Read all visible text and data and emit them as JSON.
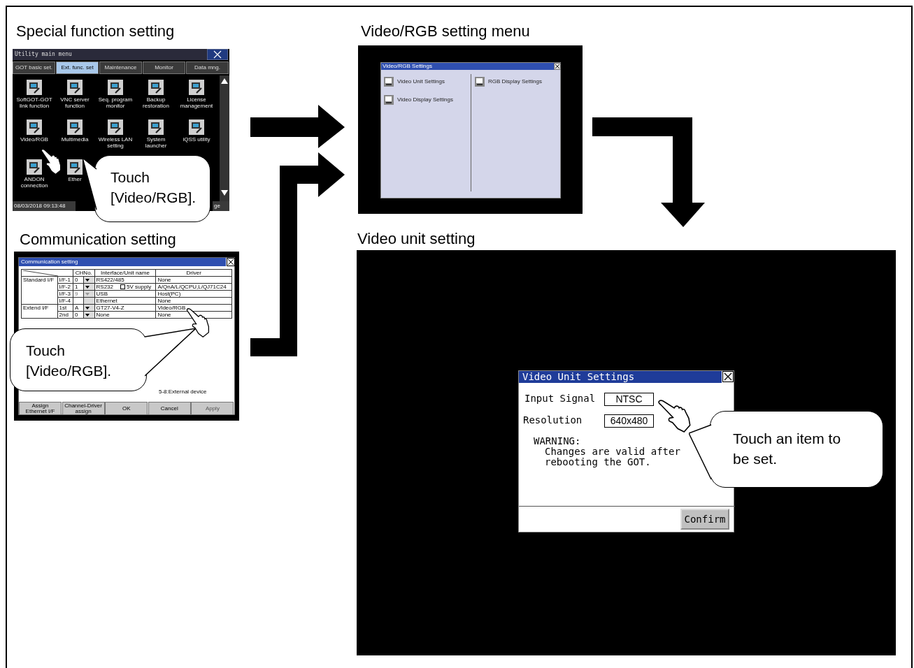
{
  "special_function": {
    "heading": "Special function setting",
    "screen": {
      "title": "Utility main menu",
      "tabs": [
        {
          "label": "GOT basic set.",
          "selected": false
        },
        {
          "label": "Ext. func. set",
          "selected": true
        },
        {
          "label": "Maintenance",
          "selected": false
        },
        {
          "label": "Monitor",
          "selected": false
        },
        {
          "label": "Data mng.",
          "selected": false
        }
      ],
      "items": [
        {
          "label": "SoftGOT-GOT link function"
        },
        {
          "label": "VNC server function"
        },
        {
          "label": "Seq. program monitor"
        },
        {
          "label": "Backup restoration"
        },
        {
          "label": "License management"
        },
        {
          "label": "Video/RGB"
        },
        {
          "label": "Multimedia"
        },
        {
          "label": "Wireless LAN setting"
        },
        {
          "label": "System launcher"
        },
        {
          "label": "iQSS utility"
        },
        {
          "label": "ANDON connection"
        },
        {
          "label": "Ether"
        }
      ],
      "datetime": "08/03/2018 09:13:48",
      "status_right": "ge"
    },
    "callout": "Touch [Video/RGB]."
  },
  "communication": {
    "heading": "Communication setting",
    "screen": {
      "title": "Communication setting",
      "columns": [
        "CHNo.",
        "Interface/Unit name",
        "Driver"
      ],
      "rows": [
        {
          "group": "Standard I/F",
          "port": "I/F-1",
          "ch": "0",
          "dropdown": {
            "disabled": false
          },
          "interface": "RS422/485",
          "driver": "None"
        },
        {
          "group": "",
          "port": "I/F-2",
          "ch": "1",
          "dropdown": {
            "disabled": false
          },
          "interface": "RS232",
          "checkbox": {
            "label": "5V supply",
            "checked": false
          },
          "driver": "A/QnA/L/QCPU,L/QJ71C24"
        },
        {
          "group": "",
          "port": "I/F-3",
          "ch": "9",
          "dropdown": {
            "disabled": true
          },
          "interface": "USB",
          "driver": "Host(PC)"
        },
        {
          "group": "",
          "port": "I/F-4",
          "ch": "",
          "interface": "Ethernet",
          "driver": "None"
        },
        {
          "group": "Extend I/F",
          "port": "1st",
          "ch": "A",
          "dropdown": {
            "disabled": false
          },
          "interface": "GT27-V4-Z",
          "driver": "Video/RGB"
        },
        {
          "group": "",
          "port": "2nd",
          "ch": "0",
          "dropdown": {
            "disabled": false
          },
          "interface": "None",
          "driver": "None"
        }
      ],
      "note": "5-8:External device",
      "buttons": [
        {
          "label": "Assign Ethernet I/F",
          "disabled": false
        },
        {
          "label": "Channel-Driver assign",
          "disabled": false
        },
        {
          "label": "OK",
          "disabled": false
        },
        {
          "label": "Cancel",
          "disabled": false
        },
        {
          "label": "Apply",
          "disabled": true
        }
      ]
    },
    "callout": "Touch [Video/RGB]."
  },
  "video_rgb_menu": {
    "heading": "Video/RGB setting menu",
    "screen": {
      "title": "Video/RGB Settings",
      "left_items": [
        {
          "label": "Video Unit Settings"
        },
        {
          "label": "Video Display Settings"
        }
      ],
      "right_items": [
        {
          "label": "RGB Display Settings"
        }
      ]
    }
  },
  "video_unit": {
    "heading": "Video unit setting",
    "dialog": {
      "title": "Video Unit Settings",
      "fields": [
        {
          "label": "Input Signal",
          "value": "NTSC"
        },
        {
          "label": "Resolution",
          "value": "640x480"
        }
      ],
      "warning_title": "WARNING:",
      "warning_lines": [
        "Changes are valid after",
        "rebooting the GOT."
      ],
      "button": "Confirm"
    },
    "callout": "Touch an item to be set."
  }
}
